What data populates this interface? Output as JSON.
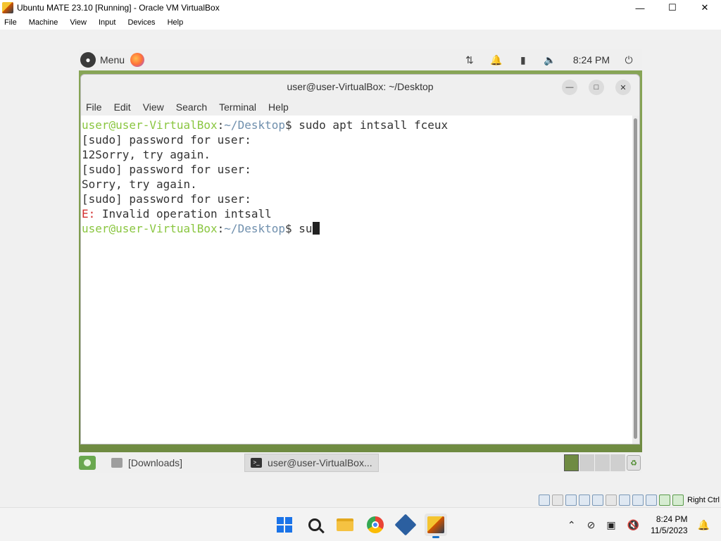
{
  "host": {
    "title": "Ubuntu MATE 23.10 [Running] - Oracle VM VirtualBox",
    "win_buttons": [
      "—",
      "☐",
      "✕"
    ],
    "menu": [
      "File",
      "Machine",
      "View",
      "Input",
      "Devices",
      "Help"
    ],
    "status_label": "Right Ctrl"
  },
  "guest": {
    "top_panel": {
      "menu_label": "Menu",
      "clock": "8:24 PM"
    },
    "terminal": {
      "title": "user@user-VirtualBox: ~/Desktop",
      "menu": [
        "File",
        "Edit",
        "View",
        "Search",
        "Terminal",
        "Help"
      ],
      "prompt_user": "user@user-VirtualBox",
      "prompt_sep": ":",
      "prompt_path": "~/Desktop",
      "prompt_end": "$ ",
      "cmd1": "sudo apt intsall fceux",
      "lines": [
        "[sudo] password for user: ",
        "12Sorry, try again.",
        "[sudo] password for user: ",
        "Sorry, try again.",
        "[sudo] password for user: "
      ],
      "error_prefix": "E:",
      "error_text": " Invalid operation intsall",
      "cmd2": "su"
    },
    "bottom_panel": {
      "tasks": [
        "[Downloads]",
        "user@user-VirtualBox..."
      ]
    }
  },
  "taskbar": {
    "time": "8:24 PM",
    "date": "11/5/2023",
    "tray_chevron": "⌃"
  },
  "icons": {
    "menu": "ubuntu-mate-icon",
    "firefox": "firefox-icon",
    "start": "windows-start-icon",
    "search": "search-icon",
    "files": "file-explorer-icon",
    "chrome": "chrome-icon",
    "virtualbox": "virtualbox-icon"
  }
}
